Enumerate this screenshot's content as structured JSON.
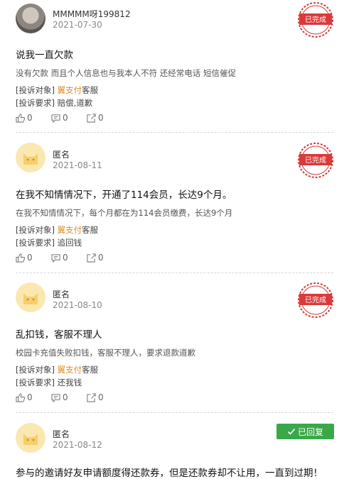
{
  "labels": {
    "target_prefix": "[投诉对象]",
    "demand_prefix": "[投诉要求]",
    "target_brand": "翼支付",
    "target_suffix": "客服"
  },
  "colors": {
    "brand_orange": "#e08a1e",
    "stamp_red": "#d93a3a",
    "replied_green": "#3aa84a"
  },
  "posts": [
    {
      "user": "MMMMM呀199812",
      "date": "2021-07-30",
      "status": "已完成",
      "title": "说我一直欠款",
      "description": "没有欠款 而且个人信息也与我本人不符 还经常电话 短信催促",
      "demand": "赔偿,道歉",
      "likes": "0",
      "comments": "0",
      "shares": "0"
    },
    {
      "user": "匿名",
      "date": "2021-08-11",
      "status": "已完成",
      "title": "在我不知情情况下，开通了114会员，长达9个月。",
      "description": "在我不知情情况下，每个月都在为114会员缴费，长达9个月",
      "demand": "追回钱",
      "likes": "0",
      "comments": "0",
      "shares": "0"
    },
    {
      "user": "匿名",
      "date": "2021-08-10",
      "status": "已完成",
      "title": "乱扣钱，客服不理人",
      "description": "校园卡充值失败扣钱，客服不理人，要求退款道歉",
      "demand": "还我钱",
      "likes": "0",
      "comments": "0",
      "shares": "0"
    },
    {
      "user": "匿名",
      "date": "2021-08-12",
      "status": "已回复",
      "title": "参与的邀请好友申请额度得还款券，但是还款券却不让用，一直到过期！"
    }
  ]
}
